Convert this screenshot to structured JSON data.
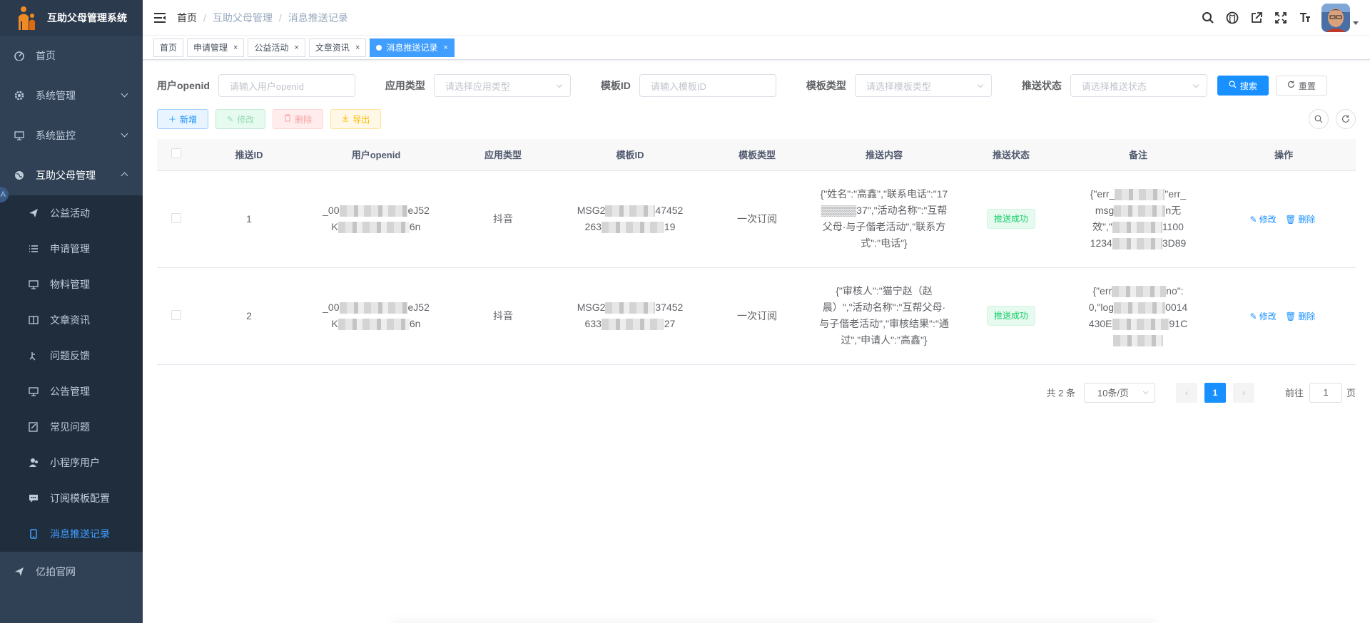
{
  "app": {
    "title": "互助父母管理系统"
  },
  "sidebar": {
    "items": [
      {
        "label": "首页",
        "icon": "dashboard-icon"
      },
      {
        "label": "系统管理",
        "icon": "gear-icon",
        "expandable": true
      },
      {
        "label": "系统监控",
        "icon": "monitor-icon",
        "expandable": true
      },
      {
        "label": "互助父母管理",
        "icon": "globe-icon",
        "expanded": true
      }
    ],
    "subitems": [
      {
        "label": "公益活动",
        "icon": "send-icon"
      },
      {
        "label": "申请管理",
        "icon": "list-icon"
      },
      {
        "label": "物料管理",
        "icon": "monitor-icon"
      },
      {
        "label": "文章资讯",
        "icon": "book-icon"
      },
      {
        "label": "问题反馈",
        "icon": "feedback-icon"
      },
      {
        "label": "公告管理",
        "icon": "monitor-icon"
      },
      {
        "label": "常见问题",
        "icon": "edit-icon"
      },
      {
        "label": "小程序用户",
        "icon": "users-icon"
      },
      {
        "label": "订阅模板配置",
        "icon": "message-icon"
      },
      {
        "label": "消息推送记录",
        "icon": "phone-icon",
        "active": true
      }
    ],
    "bottom_item": {
      "label": "亿拍官网",
      "icon": "send-icon"
    },
    "float_badge": "A"
  },
  "breadcrumb": [
    "首页",
    "互助父母管理",
    "消息推送记录"
  ],
  "tags": [
    {
      "label": "首页",
      "closable": false
    },
    {
      "label": "申请管理",
      "closable": true
    },
    {
      "label": "公益活动",
      "closable": true
    },
    {
      "label": "文章资讯",
      "closable": true
    },
    {
      "label": "消息推送记录",
      "closable": true,
      "active": true
    }
  ],
  "tag_close": "×",
  "search": {
    "fields": [
      {
        "label": "用户openid",
        "placeholder": "请输入用户openid",
        "type": "input"
      },
      {
        "label": "应用类型",
        "placeholder": "请选择应用类型",
        "type": "select"
      },
      {
        "label": "模板ID",
        "placeholder": "请输入模板ID",
        "type": "input"
      },
      {
        "label": "模板类型",
        "placeholder": "请选择模板类型",
        "type": "select"
      },
      {
        "label": "推送状态",
        "placeholder": "请选择推送状态",
        "type": "select"
      }
    ],
    "search_label": "搜索",
    "reset_label": "重置"
  },
  "toolbar": {
    "add": "新增",
    "edit": "修改",
    "delete": "删除",
    "export": "导出"
  },
  "table": {
    "columns": [
      "推送ID",
      "用户openid",
      "应用类型",
      "模板ID",
      "模板类型",
      "推送内容",
      "推送状态",
      "备注",
      "操作"
    ],
    "rows": [
      {
        "id": "1",
        "openid_l1_pre": "_00",
        "openid_l1_post": "eJ52",
        "openid_l2_pre": "K",
        "openid_l2_post": "6n",
        "app_type": "抖音",
        "tpl_l1_pre": "MSG2",
        "tpl_l1_post": "47452",
        "tpl_l2_pre": "263",
        "tpl_l2_post": "19",
        "tpl_type": "一次订阅",
        "content": "{\"姓名\":\"高鑫\",\"联系电话\":\"17▒▒▒▒▒37\",\"活动名称\":\"互帮父母·与子偕老活动\",\"联系方式\":\"电话\"}",
        "status": "推送成功",
        "remark_l1_pre": "{\"err_",
        "remark_l1_post": "\"err_",
        "remark_l2_pre": "msg",
        "remark_l2_post": "n无",
        "remark_l3_pre": "效\",\"",
        "remark_l3_post": "1100",
        "remark_l4_pre": "1234",
        "remark_l4_post": "3D89"
      },
      {
        "id": "2",
        "openid_l1_pre": "_00",
        "openid_l1_post": "eJ52",
        "openid_l2_pre": "K",
        "openid_l2_post": "6n",
        "app_type": "抖音",
        "tpl_l1_pre": "MSG2",
        "tpl_l1_post": "37452",
        "tpl_l2_pre": "633",
        "tpl_l2_post": "27",
        "tpl_type": "一次订阅",
        "content": "{\"审核人\":\"猫宁赵（赵晨）\",\"活动名称\":\"互帮父母·与子偕老活动\",\"审核结果\":\"通过\",\"申请人\":\"高鑫\"}",
        "status": "推送成功",
        "remark_l1_pre": "{\"err",
        "remark_l1_post": "no\":",
        "remark_l2_pre": "0,\"log",
        "remark_l2_post": "0014",
        "remark_l3_pre": "430E",
        "remark_l3_post": "91C",
        "remark_l4_pre": "",
        "remark_l4_post": ""
      }
    ],
    "op_edit": "修改",
    "op_delete": "删除"
  },
  "pagination": {
    "total": "共 2 条",
    "page_size": "10条/页",
    "current": "1",
    "goto_prefix": "前往",
    "goto_value": "1",
    "goto_suffix": "页"
  },
  "colors": {
    "sidebar_bg": "#304156",
    "submenu_bg": "#1f2d3d",
    "accent": "#1890ff",
    "success": "#13ce66"
  }
}
